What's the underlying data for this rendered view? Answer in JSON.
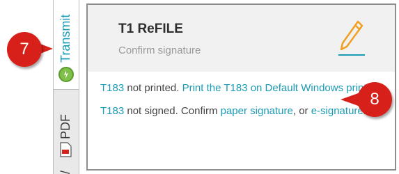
{
  "tabs": {
    "transmit_label": "Transmit",
    "pdf_label": "PDF",
    "slash_label": "/"
  },
  "card": {
    "title": "T1 ReFILE",
    "subtitle": "Confirm signature",
    "edit_icon": "pencil-icon"
  },
  "messages": {
    "msg1_link_a": "T183",
    "msg1_text_a": " not printed. ",
    "msg1_link_b": "Print the T183 on Default Windows printer",
    "msg1_text_b": ".",
    "msg2_link_a": "T183",
    "msg2_text_a": " not signed. Confirm ",
    "msg2_link_b": "paper signature",
    "msg2_text_b": ", or ",
    "msg2_link_c": "e-signature",
    "msg2_text_c": "."
  },
  "callouts": {
    "seven": "7",
    "eight": "8"
  },
  "colors": {
    "accent": "#1a9bb5",
    "callout_red": "#d8201a",
    "pencil_orange": "#f0a020",
    "transmit_green": "#7fbf4a"
  }
}
